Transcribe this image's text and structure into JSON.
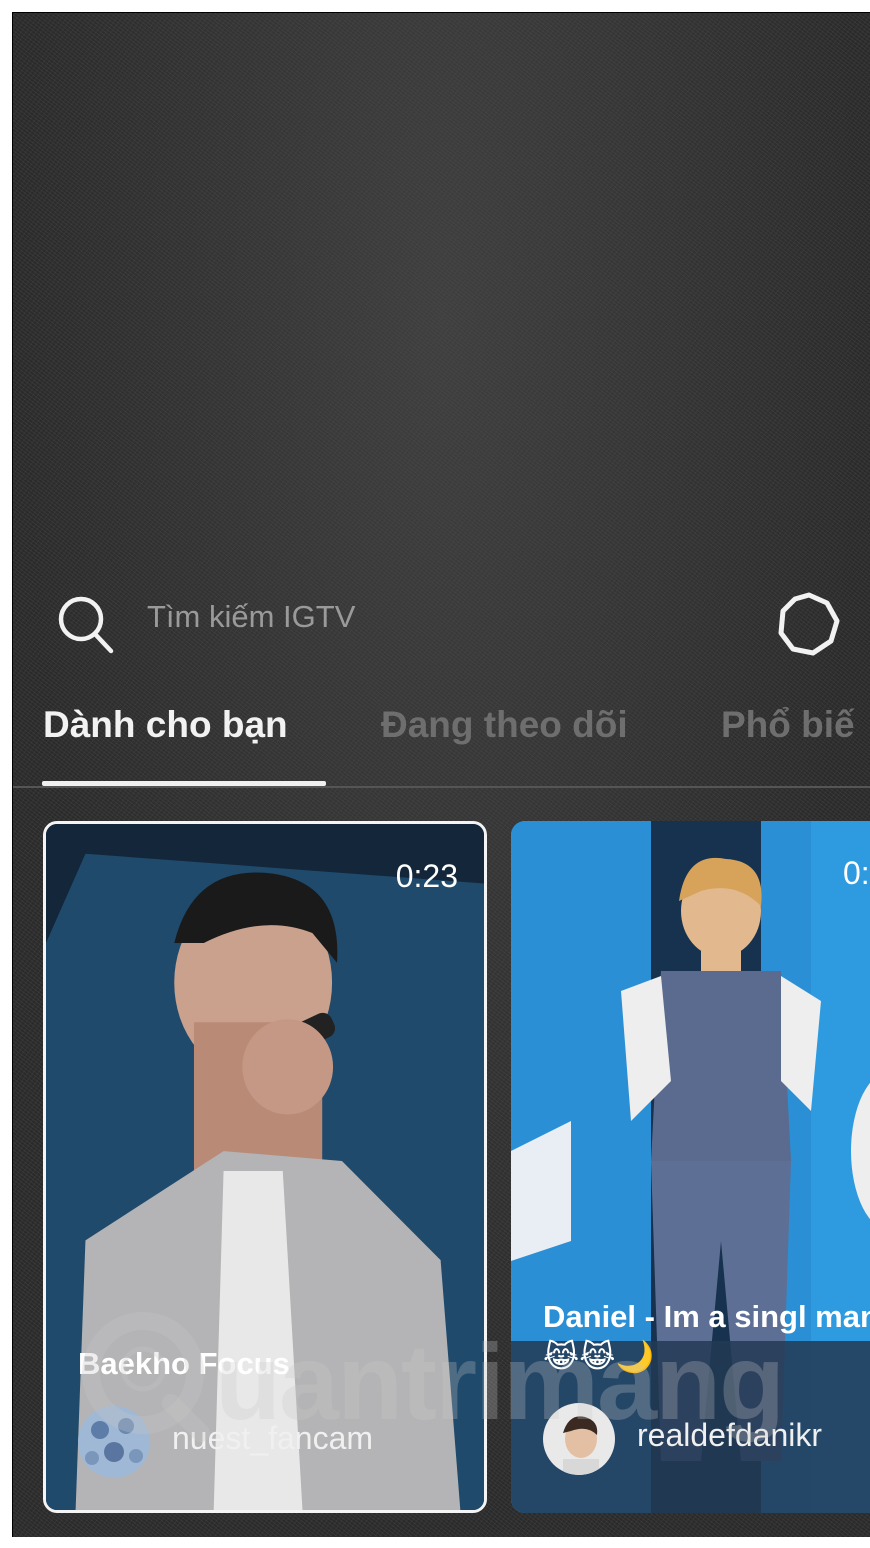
{
  "search": {
    "placeholder": "Tìm kiếm IGTV"
  },
  "tabs": [
    {
      "label": "Dành cho bạn",
      "active": true
    },
    {
      "label": "Đang theo dõi",
      "active": false
    },
    {
      "label": "Phổ biế",
      "active": false
    }
  ],
  "cards": [
    {
      "duration": "0:23",
      "title": "Baekho Focus",
      "owner": "nuest_fancam",
      "selected": true
    },
    {
      "duration": "0:",
      "title": "Daniel - Im a singl man 😹😹🌙",
      "owner": "realdefdanikr",
      "selected": false
    }
  ],
  "watermark": {
    "text": "uantrimang"
  },
  "colors": {
    "background": "#2a2a2a",
    "active_tab": "#f2f2f2",
    "inactive_tab": "#6e6e6e",
    "placeholder": "#9a9a9a"
  }
}
